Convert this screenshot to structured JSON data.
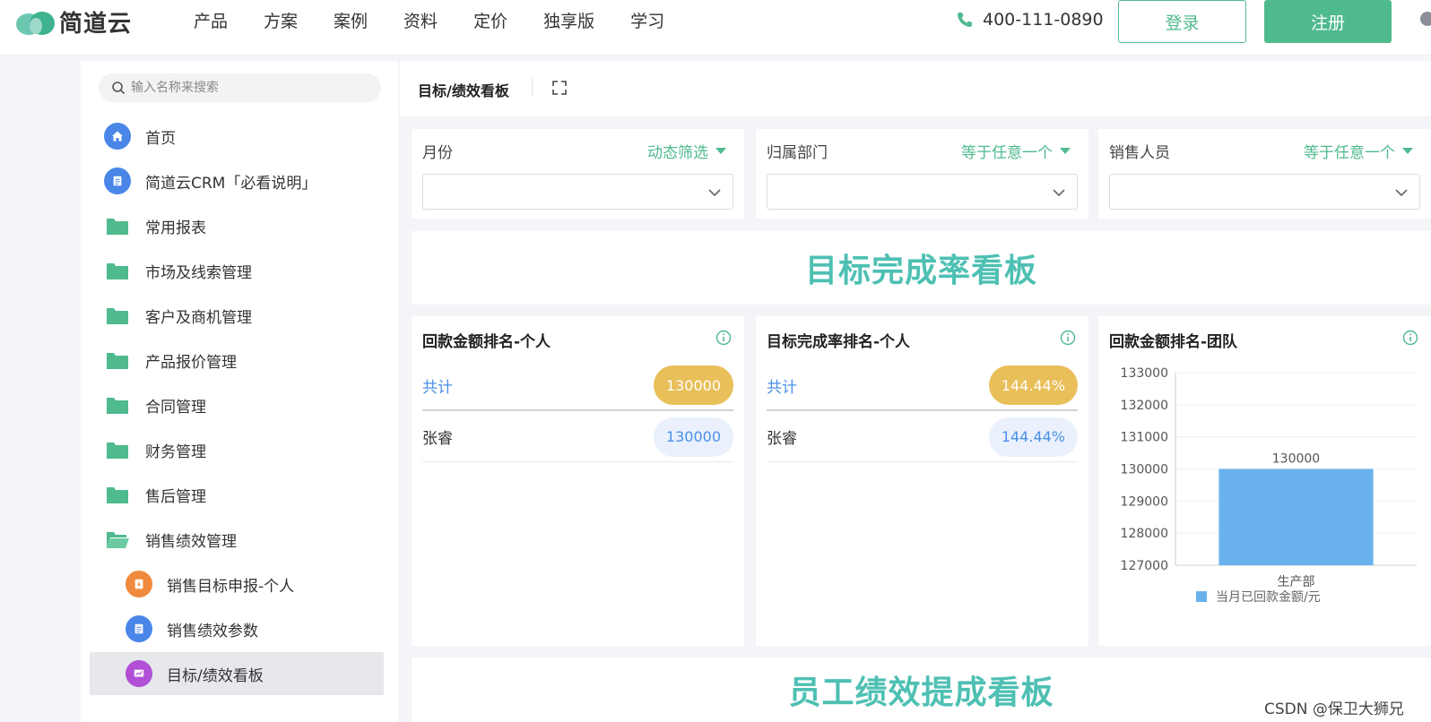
{
  "brand": {
    "name": "简道云"
  },
  "nav": [
    "产品",
    "方案",
    "案例",
    "资料",
    "定价",
    "独享版",
    "学习"
  ],
  "phone": "400-111-0890",
  "login_label": "登录",
  "register_label": "注册",
  "sidebar": {
    "search_placeholder": "输入名称来搜索",
    "items": [
      {
        "label": "首页",
        "icon": "home-icon"
      },
      {
        "label": "简道云CRM「必看说明」",
        "icon": "document-icon"
      },
      {
        "label": "常用报表",
        "icon": "folder-icon"
      },
      {
        "label": "市场及线索管理",
        "icon": "folder-icon"
      },
      {
        "label": "客户及商机管理",
        "icon": "folder-icon"
      },
      {
        "label": "产品报价管理",
        "icon": "folder-icon"
      },
      {
        "label": "合同管理",
        "icon": "folder-icon"
      },
      {
        "label": "财务管理",
        "icon": "folder-icon"
      },
      {
        "label": "售后管理",
        "icon": "folder-icon"
      },
      {
        "label": "销售绩效管理",
        "icon": "folder-open-icon"
      },
      {
        "label": "销售目标申报-个人",
        "icon": "form-icon"
      },
      {
        "label": "销售绩效参数",
        "icon": "document-icon"
      },
      {
        "label": "目标/绩效看板",
        "icon": "dashboard-icon",
        "active": true
      }
    ]
  },
  "header": {
    "title": "目标/绩效看板"
  },
  "filters": [
    {
      "name": "月份",
      "mode": "动态筛选"
    },
    {
      "name": "归属部门",
      "mode": "等于任意一个"
    },
    {
      "name": "销售人员",
      "mode": "等于任意一个"
    }
  ],
  "banner1": "目标完成率看板",
  "banner2": "员工绩效提成看板",
  "cards": {
    "c1": {
      "title": "回款金额排名-个人",
      "total_label": "共计",
      "total_value": "130000",
      "row_name": "张睿",
      "row_value": "130000"
    },
    "c2": {
      "title": "目标完成率排名-个人",
      "total_label": "共计",
      "total_value": "144.44%",
      "row_name": "张睿",
      "row_value": "144.44%"
    },
    "c3": {
      "title": "回款金额排名-团队"
    }
  },
  "chart_data": {
    "type": "bar",
    "categories": [
      "生产部"
    ],
    "series": [
      {
        "name": "当月已回款金额/元",
        "values": [
          130000
        ]
      }
    ],
    "data_labels": [
      "130000"
    ],
    "ylim": [
      127000,
      133000
    ],
    "yticks": [
      "133000",
      "132000",
      "131000",
      "130000",
      "129000",
      "128000",
      "127000"
    ],
    "legend_position": "bottom",
    "grid": true,
    "bar_color": "#6ab2ee"
  },
  "watermark": "CSDN @保卫大狮兄",
  "colors": {
    "accent": "#4fba8e",
    "banner": "#4ec0b3",
    "gold": "#e9bf5a",
    "blue_text": "#4a8fe7"
  }
}
